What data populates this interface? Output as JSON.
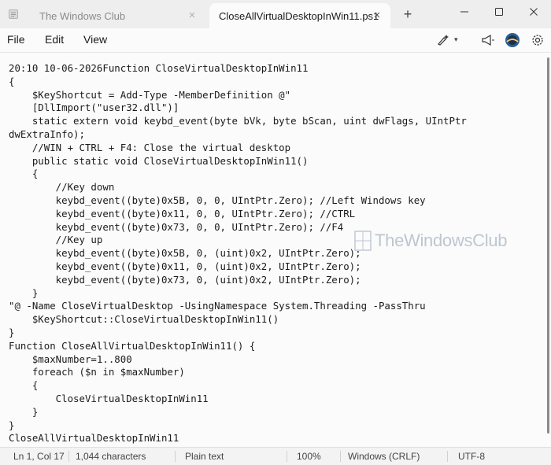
{
  "tabs": [
    {
      "label": "The Windows Club",
      "active": false
    },
    {
      "label": "CloseAllVirtualDesktopInWin11.ps1",
      "active": true
    }
  ],
  "menu": [
    "File",
    "Edit",
    "View"
  ],
  "toolbar_icons": [
    "copilot-write-icon",
    "announcement-icon",
    "account-avatar-icon",
    "settings-gear-icon"
  ],
  "code_lines": [
    "20:10 10-06-2026Function CloseVirtualDesktopInWin11",
    "{",
    "    $KeyShortcut = Add-Type -MemberDefinition @\"",
    "    [DllImport(\"user32.dll\")]",
    "    static extern void keybd_event(byte bVk, byte bScan, uint dwFlags, UIntPtr",
    "dwExtraInfo);",
    "    //WIN + CTRL + F4: Close the virtual desktop",
    "    public static void CloseVirtualDesktopInWin11()",
    "    {",
    "        //Key down",
    "        keybd_event((byte)0x5B, 0, 0, UIntPtr.Zero); //Left Windows key",
    "        keybd_event((byte)0x11, 0, 0, UIntPtr.Zero); //CTRL",
    "        keybd_event((byte)0x73, 0, 0, UIntPtr.Zero); //F4",
    "        //Key up",
    "        keybd_event((byte)0x5B, 0, (uint)0x2, UIntPtr.Zero);",
    "        keybd_event((byte)0x11, 0, (uint)0x2, UIntPtr.Zero);",
    "        keybd_event((byte)0x73, 0, (uint)0x2, UIntPtr.Zero);",
    "    }",
    "\"@ -Name CloseVirtualDesktop -UsingNamespace System.Threading -PassThru",
    "    $KeyShortcut::CloseVirtualDesktopInWin11()",
    "}",
    "Function CloseAllVirtualDesktopInWin11() {",
    "    $maxNumber=1..800",
    "    foreach ($n in $maxNumber)",
    "    {",
    "        CloseVirtualDesktopInWin11",
    "    }",
    "}",
    "CloseAllVirtualDesktopInWin11"
  ],
  "watermark": "TheWindowsClub",
  "status": {
    "position": "Ln 1, Col 17",
    "characters": "1,044 characters",
    "format": "Plain text",
    "zoom": "100%",
    "line_ending": "Windows (CRLF)",
    "encoding": "UTF-8"
  }
}
